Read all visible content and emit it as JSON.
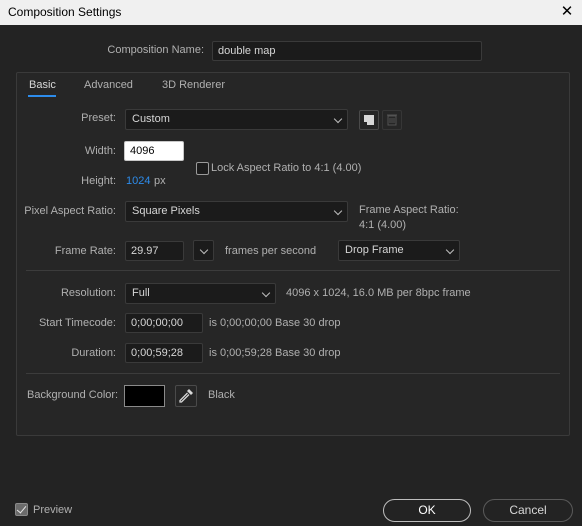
{
  "window": {
    "title": "Composition Settings",
    "close_glyph": "✕"
  },
  "comp_name": {
    "label": "Composition Name:",
    "value": "double map"
  },
  "tabs": [
    {
      "label": "Basic"
    },
    {
      "label": "Advanced"
    },
    {
      "label": "3D Renderer"
    }
  ],
  "basic": {
    "preset": {
      "label": "Preset:",
      "value": "Custom"
    },
    "width": {
      "label": "Width:",
      "value": "4096"
    },
    "height": {
      "label": "Height:",
      "value": "1024",
      "unit": "px"
    },
    "lock_aspect": {
      "label": "Lock Aspect Ratio to 4:1 (4.00)",
      "checked": false
    },
    "pixel_aspect": {
      "label": "Pixel Aspect Ratio:",
      "value": "Square Pixels"
    },
    "frame_aspect": {
      "label": "Frame Aspect Ratio:",
      "value": "4:1 (4.00)"
    },
    "frame_rate": {
      "label": "Frame Rate:",
      "value": "29.97",
      "unit": "frames per second",
      "drop": "Drop Frame"
    },
    "resolution": {
      "label": "Resolution:",
      "value": "Full",
      "info": "4096 x 1024, 16.0 MB per 8bpc frame"
    },
    "start_timecode": {
      "label": "Start Timecode:",
      "value": "0;00;00;00",
      "info": "is 0;00;00;00  Base 30  drop"
    },
    "duration": {
      "label": "Duration:",
      "value": "0;00;59;28",
      "info": "is 0;00;59;28  Base 30  drop"
    },
    "background": {
      "label": "Background Color:",
      "color_name": "Black",
      "color": "#000000"
    }
  },
  "footer": {
    "preview_label": "Preview",
    "preview_checked": true,
    "ok_label": "OK",
    "cancel_label": "Cancel"
  },
  "icons": {
    "save_preset": "save-icon",
    "delete_preset": "trash-icon",
    "eyedropper": "eyedropper-icon"
  },
  "colors": {
    "accent": "#2d8ceb",
    "background": "#232323"
  }
}
